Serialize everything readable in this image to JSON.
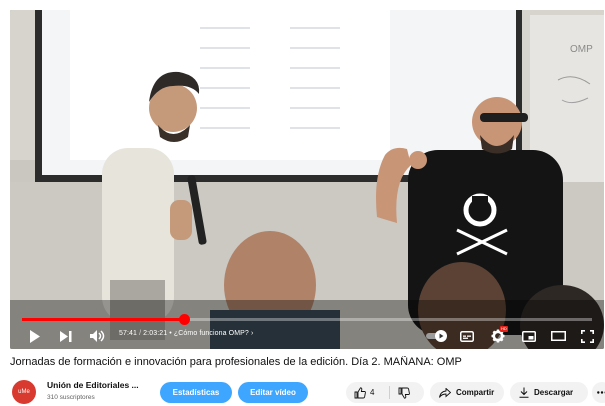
{
  "video": {
    "title": "Jornadas de formación e innovación para profesionales de la edición. Día 2. MAÑANA: OMP",
    "progress": 0.2846,
    "current_time": "57:41",
    "separator": "/",
    "duration": "2:03:21",
    "chapter": "• ¿Cómo funciona OMP? ›",
    "whiteboard_text": "OMP"
  },
  "controls": {
    "play": "play-icon",
    "next": "next-icon",
    "volume": "volume-icon",
    "autoplay": "autoplay-toggle",
    "subtitles": "subtitles-icon",
    "settings": "gear-icon",
    "settings_badge": "HD",
    "miniplayer": "miniplayer-icon",
    "theater": "theater-icon",
    "fullscreen": "fullscreen-icon"
  },
  "channel": {
    "avatar_text": "uMe",
    "name": "Unión de Editoriales ...",
    "subscribers": "310 suscriptores",
    "avatar_color": "#d83a2f"
  },
  "actions": {
    "stats_label": "Estadísticas",
    "edit_label": "Editar vídeo",
    "like_count": "4",
    "share_label": "Compartir",
    "download_label": "Descargar",
    "more": "more-icon"
  },
  "colors": {
    "accent_blue": "#3ea6ff",
    "progress_red": "#ff0000"
  }
}
